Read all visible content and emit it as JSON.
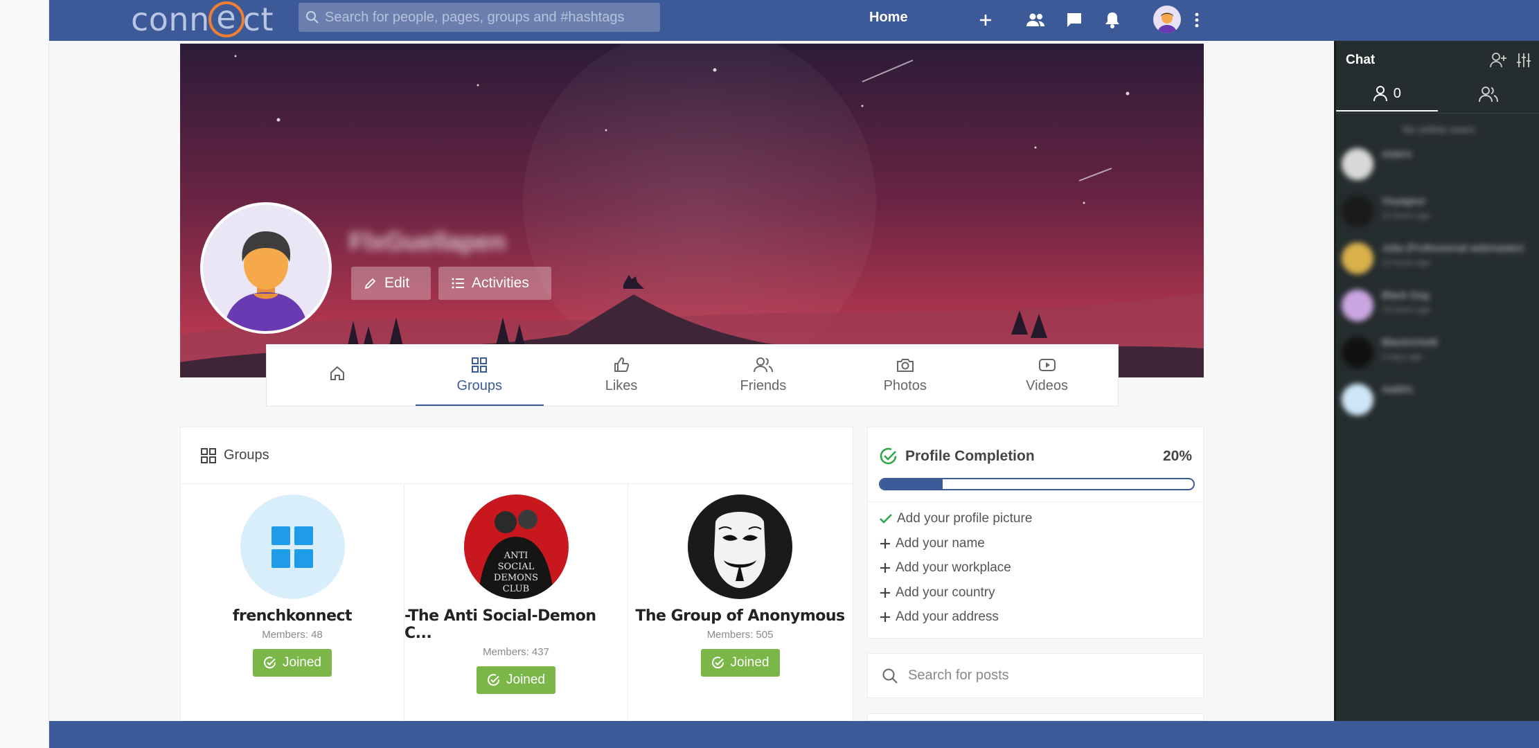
{
  "topbar": {
    "logo": "connect",
    "search_placeholder": "Search for people, pages, groups and #hashtags",
    "home_label": "Home"
  },
  "profile": {
    "name": "FlxGuellapen",
    "edit_label": "Edit",
    "activities_label": "Activities"
  },
  "tabs": [
    {
      "label": ""
    },
    {
      "label": "Groups",
      "active": true
    },
    {
      "label": "Likes"
    },
    {
      "label": "Friends"
    },
    {
      "label": "Photos"
    },
    {
      "label": "Videos"
    }
  ],
  "groups": {
    "header": "Groups",
    "items": [
      {
        "name": "frenchkonnect",
        "members": "Members: 48",
        "status": "Joined"
      },
      {
        "name": "-The Anti Social-Demon C...",
        "members": "Members: 437",
        "status": "Joined",
        "image_text": [
          "ANTI",
          "SOCIAL",
          "DEMONS",
          "CLUB"
        ]
      },
      {
        "name": "The Group of Anonymous",
        "members": "Members: 505",
        "status": "Joined"
      }
    ]
  },
  "completion": {
    "title": "Profile Completion",
    "percent_label": "20%",
    "percent": 20,
    "tasks": [
      {
        "label": "Add your profile picture",
        "done": true
      },
      {
        "label": "Add your name",
        "done": false
      },
      {
        "label": "Add your workplace",
        "done": false
      },
      {
        "label": "Add your country",
        "done": false
      },
      {
        "label": "Add your address",
        "done": false
      }
    ]
  },
  "post_search": {
    "placeholder": "Search for posts"
  },
  "chat": {
    "title": "Chat",
    "online_count": "0",
    "no_online": "No online users",
    "contacts": [
      {
        "name": "sisters",
        "time": ""
      },
      {
        "name": "Voyageur",
        "time": "12 hours ago"
      },
      {
        "name": "Julia (Professional webmaster)",
        "time": "12 hours ago"
      },
      {
        "name": "Black Dog",
        "time": "13 hours ago"
      },
      {
        "name": "Blackrichetti",
        "time": "2 days ago"
      },
      {
        "name": "Aaldric",
        "time": ""
      }
    ]
  },
  "colors": {
    "brand": "#3c5998",
    "joined": "#7ab648",
    "chat_bg": "#262d2f",
    "logo_accent": "#f07f31"
  }
}
